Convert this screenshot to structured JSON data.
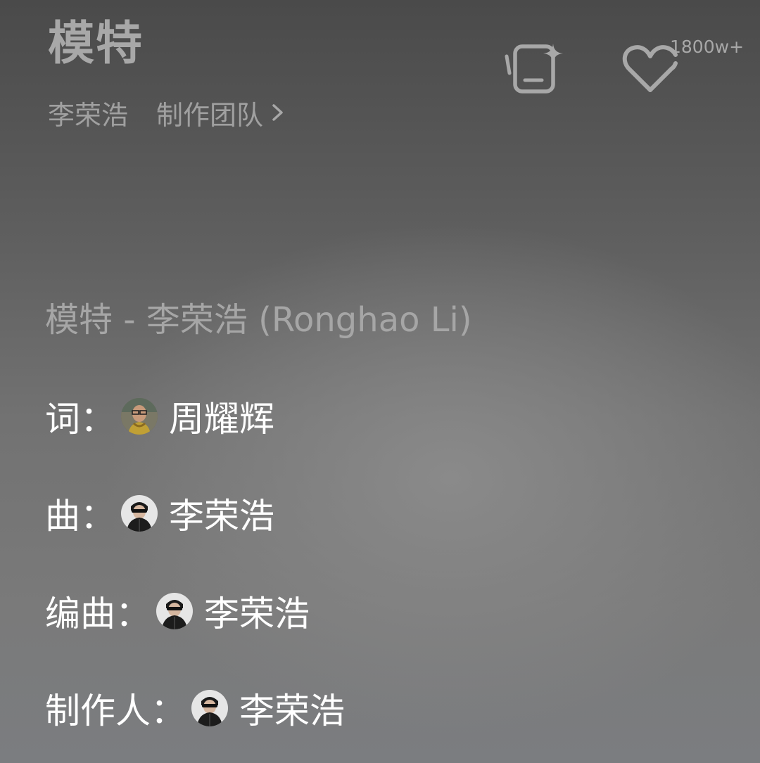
{
  "song": {
    "title": "模特",
    "artist": "李荣浩",
    "team_link": "制作团队",
    "like_count": "1800w+"
  },
  "icons": {
    "add_playlist": "add-to-playlist-icon",
    "like": "heart-icon",
    "chevron": "chevron-right-icon"
  },
  "lyrics": {
    "header": "模特 - 李荣浩 (Ronghao Li)",
    "credits": [
      {
        "role": "词：",
        "name": "周耀辉"
      },
      {
        "role": "曲：",
        "name": "李荣浩"
      },
      {
        "role": "编曲：",
        "name": "李荣浩"
      },
      {
        "role": "制作人：",
        "name": "李荣浩"
      }
    ]
  },
  "colors": {
    "title": "#a8a8a8",
    "subtitle": "#a0a0a0",
    "credit_text": "#ffffff",
    "icon_stroke": "#a8a8a8"
  }
}
